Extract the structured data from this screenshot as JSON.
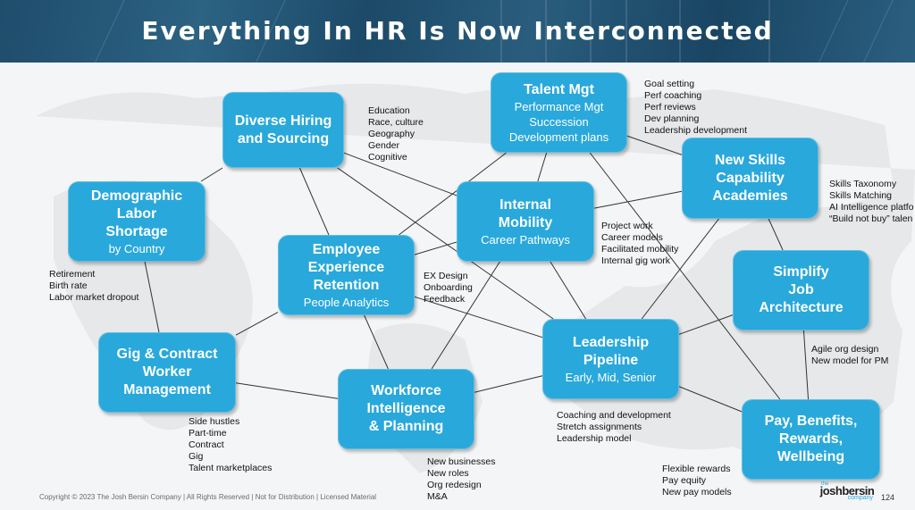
{
  "title": "Everything In HR Is Now Interconnected",
  "nodes": {
    "diverse_hiring": {
      "heading": [
        "Diverse Hiring",
        "and Sourcing"
      ],
      "sub": [],
      "notes": [
        "Education",
        "Race, culture",
        "Geography",
        "Gender",
        "Cognitive"
      ]
    },
    "talent_mgt": {
      "heading": [
        "Talent Mgt"
      ],
      "sub": [
        "Performance Mgt",
        "Succession",
        "Development plans"
      ],
      "notes": [
        "Goal setting",
        "Perf coaching",
        "Perf reviews",
        "Dev planning",
        "Leadership development"
      ]
    },
    "new_skills": {
      "heading": [
        "New Skills",
        "Capability",
        "Academies"
      ],
      "sub": [],
      "notes": [
        "Skills Taxonomy",
        "Skills Matching",
        "AI Intelligence platfo",
        "“Build not buy” talen"
      ]
    },
    "demographic": {
      "heading": [
        "Demographic",
        "Labor",
        "Shortage"
      ],
      "sub": [
        "by Country"
      ],
      "notes": [
        "Retirement",
        "Birth rate",
        "Labor market dropout"
      ]
    },
    "internal_mobility": {
      "heading": [
        "Internal",
        "Mobility"
      ],
      "sub": [
        "Career Pathways"
      ],
      "notes": [
        "Project work",
        "Career models",
        "Facilitated mobility",
        "Internal gig work"
      ]
    },
    "employee_experience": {
      "heading": [
        "Employee",
        "Experience",
        "Retention"
      ],
      "sub": [
        "People Analytics"
      ],
      "notes": [
        "EX Design",
        "Onboarding",
        "Feedback"
      ]
    },
    "simplify_job": {
      "heading": [
        "Simplify",
        "Job",
        "Architecture"
      ],
      "sub": [],
      "notes": [
        "Agile org design",
        "New model for PM"
      ]
    },
    "gig_contract": {
      "heading": [
        "Gig & Contract",
        "Worker",
        "Management"
      ],
      "sub": [],
      "notes": [
        "Side hustles",
        "Part-time",
        "Contract",
        "Gig",
        "Talent marketplaces"
      ]
    },
    "leadership": {
      "heading": [
        "Leadership",
        "Pipeline"
      ],
      "sub": [
        "Early, Mid, Senior"
      ],
      "notes": [
        "Coaching and development",
        "Stretch assignments",
        "Leadership model"
      ]
    },
    "workforce": {
      "heading": [
        "Workforce",
        "Intelligence",
        "& Planning"
      ],
      "sub": [],
      "notes": [
        "New businesses",
        "New roles",
        "Org redesign",
        "M&A"
      ]
    },
    "pay": {
      "heading": [
        "Pay, Benefits,",
        "Rewards,",
        "Wellbeing"
      ],
      "sub": [],
      "notes": [
        "Flexible rewards",
        "Pay equity",
        "New pay models"
      ]
    }
  },
  "connections": [
    [
      "diverse_hiring",
      "demographic"
    ],
    [
      "diverse_hiring",
      "employee_experience"
    ],
    [
      "diverse_hiring",
      "internal_mobility"
    ],
    [
      "diverse_hiring",
      "leadership"
    ],
    [
      "talent_mgt",
      "employee_experience"
    ],
    [
      "talent_mgt",
      "internal_mobility"
    ],
    [
      "talent_mgt",
      "new_skills"
    ],
    [
      "talent_mgt",
      "pay"
    ],
    [
      "new_skills",
      "internal_mobility"
    ],
    [
      "new_skills",
      "leadership"
    ],
    [
      "new_skills",
      "simplify_job"
    ],
    [
      "demographic",
      "gig_contract"
    ],
    [
      "internal_mobility",
      "leadership"
    ],
    [
      "internal_mobility",
      "workforce"
    ],
    [
      "internal_mobility",
      "employee_experience"
    ],
    [
      "employee_experience",
      "gig_contract"
    ],
    [
      "employee_experience",
      "workforce"
    ],
    [
      "employee_experience",
      "leadership"
    ],
    [
      "simplify_job",
      "leadership"
    ],
    [
      "simplify_job",
      "pay"
    ],
    [
      "gig_contract",
      "workforce"
    ],
    [
      "workforce",
      "leadership"
    ],
    [
      "leadership",
      "pay"
    ]
  ],
  "footer": "Copyright © 2023 The Josh Bersin Company | All Rights Reserved | Not for Distribution | Licensed Material",
  "logo": {
    "the": "the",
    "name": "joshbersin",
    "company": "company"
  },
  "page_number": "124",
  "colors": {
    "node": "#29a8db",
    "banner": "#1f4d6c",
    "line": "#333333"
  }
}
